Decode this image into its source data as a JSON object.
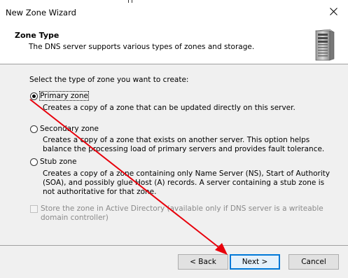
{
  "window": {
    "title": "New Zone Wizard"
  },
  "header": {
    "title": "Zone Type",
    "subtitle": "The DNS server supports various types of zones and storage.",
    "icon": "server-icon"
  },
  "content": {
    "prompt": "Select the type of zone you want to create:",
    "options": [
      {
        "label": "Primary zone",
        "checked": true,
        "description": "Creates a copy of a zone that can be updated directly on this server."
      },
      {
        "label": "Secondary zone",
        "checked": false,
        "description": "Creates a copy of a zone that exists on another server. This option helps balance the processing load of primary servers and provides fault tolerance."
      },
      {
        "label": "Stub zone",
        "checked": false,
        "description": "Creates a copy of a zone containing only Name Server (NS), Start of Authority (SOA), and possibly glue Host (A) records. A server containing a stub zone is not authoritative for that zone."
      }
    ],
    "store_ad": {
      "label": "Store the zone in Active Directory (available only if DNS server is a writeable domain controller)",
      "checked": false,
      "enabled": false
    }
  },
  "footer": {
    "back_label": "< Back",
    "next_label": "Next >",
    "cancel_label": "Cancel"
  },
  "colors": {
    "annotation": "#e8000b",
    "accent": "#0078d7"
  }
}
